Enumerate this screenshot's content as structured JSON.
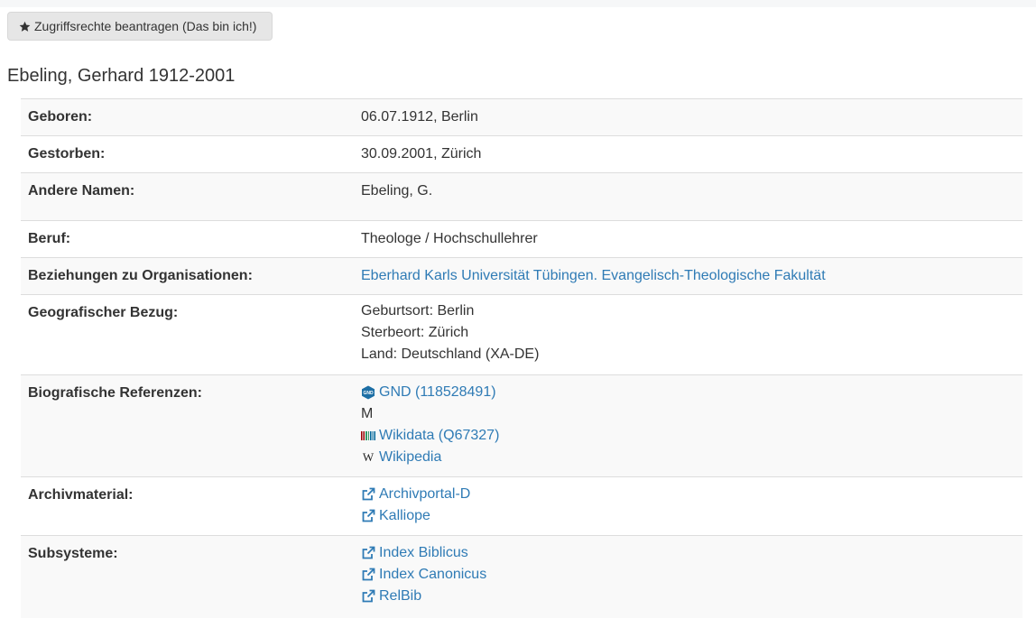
{
  "colors": {
    "link": "#2f7bb5",
    "row_alt": "#f9f9f9",
    "border": "#dddddd",
    "button_bg": "#e6e6e6"
  },
  "header": {
    "access_button": "Zugriffsrechte beantragen (Das bin ich!)",
    "access_icon": "star-icon",
    "title": "Ebeling, Gerhard 1912-2001"
  },
  "rows": {
    "born": {
      "label": "Geboren:",
      "value": "06.07.1912, Berlin"
    },
    "died": {
      "label": "Gestorben:",
      "value": "30.09.2001, Zürich"
    },
    "names": {
      "label": "Andere Namen:",
      "value": "Ebeling, G."
    },
    "job": {
      "label": "Beruf:",
      "value": "Theologe / Hochschullehrer"
    },
    "org": {
      "label": "Beziehungen zu Organisationen:",
      "value": "Eberhard Karls Universität Tübingen. Evangelisch-Theologische Fakultät"
    },
    "geo": {
      "label": "Geografischer Bezug:",
      "lines": [
        "Geburtsort: Berlin",
        "Sterbeort: Zürich",
        "Land: Deutschland (XA-DE)"
      ]
    },
    "bio": {
      "label": "Biografische Referenzen:",
      "gnd": "GND (118528491)",
      "gnd_icon": "gnd-icon",
      "m": "M",
      "wikidata": "Wikidata (Q67327)",
      "wikidata_icon": "wikidata-icon",
      "wikipedia": "Wikipedia",
      "wikipedia_icon": "wikipedia-icon",
      "wikipedia_glyph": "W"
    },
    "archive": {
      "label": "Archivmaterial:",
      "links": [
        "Archivportal-D",
        "Kalliope"
      ],
      "link_icon": "external-link-icon"
    },
    "sub": {
      "label": "Subsysteme:",
      "links": [
        "Index Biblicus",
        "Index Canonicus",
        "RelBib"
      ],
      "link_icon": "external-link-icon"
    }
  }
}
